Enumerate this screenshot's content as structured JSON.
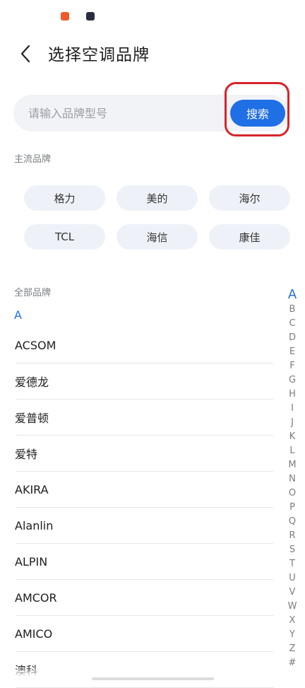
{
  "colors": {
    "accent": "#1f6fe6",
    "highlight": "#d8232a",
    "app_icon_1": "#ef5a2a",
    "app_icon_2": "#2b2d42"
  },
  "header": {
    "title": "选择空调品牌",
    "back_icon": "chevron-left-icon"
  },
  "search": {
    "placeholder": "请输入品牌型号",
    "button_label": "搜索"
  },
  "mainstream": {
    "label": "主流品牌",
    "brands": [
      "格力",
      "美的",
      "海尔",
      "TCL",
      "海信",
      "康佳"
    ]
  },
  "all_brands": {
    "label": "全部品牌",
    "current_letter": "A",
    "items": [
      "ACSOM",
      "爱德龙",
      "爱普顿",
      "爱特",
      "AKIRA",
      "Alanlin",
      "ALPIN",
      "AMCOR",
      "AMICO",
      "澳科"
    ]
  },
  "alpha_index": [
    "A",
    "B",
    "C",
    "D",
    "E",
    "F",
    "G",
    "H",
    "I",
    "J",
    "K",
    "L",
    "M",
    "N",
    "O",
    "P",
    "Q",
    "R",
    "S",
    "T",
    "U",
    "V",
    "W",
    "X",
    "Y",
    "Z",
    "#"
  ]
}
